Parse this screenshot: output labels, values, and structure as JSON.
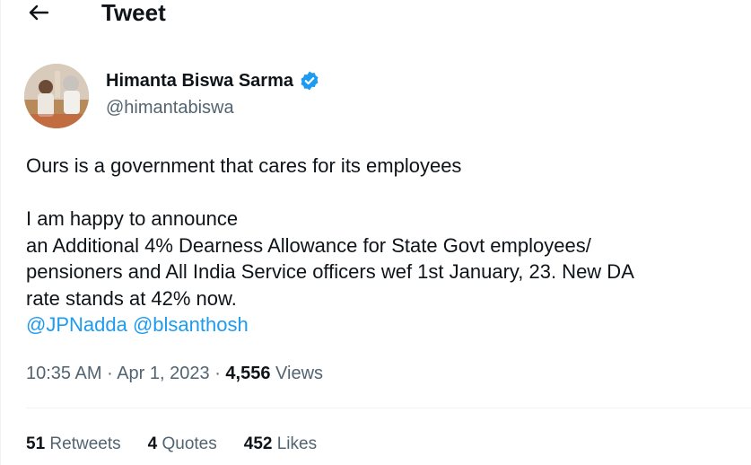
{
  "header": {
    "title": "Tweet",
    "back_icon": "arrow-left-icon"
  },
  "author": {
    "name": "Himanta Biswa Sarma",
    "handle": "@himantabiswa",
    "verified_icon": "verified-badge-icon",
    "verified_color": "#1d9bf0"
  },
  "tweet": {
    "lines": [
      "Ours is a government that cares for its employees",
      "I am happy to announce",
      "an Additional 4% Dearness Allowance for State Govt employees/",
      "pensioners and All India Service officers wef 1st January, 23. New DA",
      "rate stands at 42% now."
    ],
    "mentions": [
      "@JPNadda",
      "@blsanthosh"
    ]
  },
  "meta": {
    "time": "10:35 AM",
    "separator": "·",
    "date": "Apr 1, 2023",
    "views_count": "4,556",
    "views_label": "Views"
  },
  "stats": {
    "retweets_count": "51",
    "retweets_label": "Retweets",
    "quotes_count": "4",
    "quotes_label": "Quotes",
    "likes_count": "452",
    "likes_label": "Likes"
  },
  "colors": {
    "text_primary": "#0f1419",
    "text_secondary": "#536471",
    "link": "#1d9bf0",
    "divider": "#eff3f4"
  }
}
